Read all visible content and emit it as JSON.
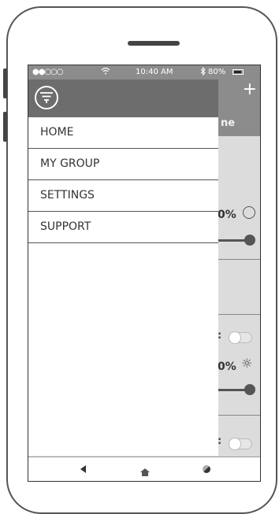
{
  "status_bar": {
    "signal": "●●○○○",
    "time": "10:40 AM",
    "battery": "80%"
  },
  "drawer": {
    "items": [
      {
        "label": "HOME"
      },
      {
        "label": "MY GROUP"
      },
      {
        "label": "SETTINGS"
      },
      {
        "label": "SUPPORT"
      }
    ]
  },
  "background": {
    "title_fragment": "ne",
    "level_1": "0%",
    "level_2": "0%",
    "colon": ":"
  },
  "icons": {
    "add": "plus-icon",
    "fan": "fan-icon",
    "light": "sun-icon",
    "logo": "menu-logo-icon"
  },
  "colors": {
    "header": "#8c8c8c",
    "drawer_header": "#6d6d6d",
    "text": "#333333"
  }
}
